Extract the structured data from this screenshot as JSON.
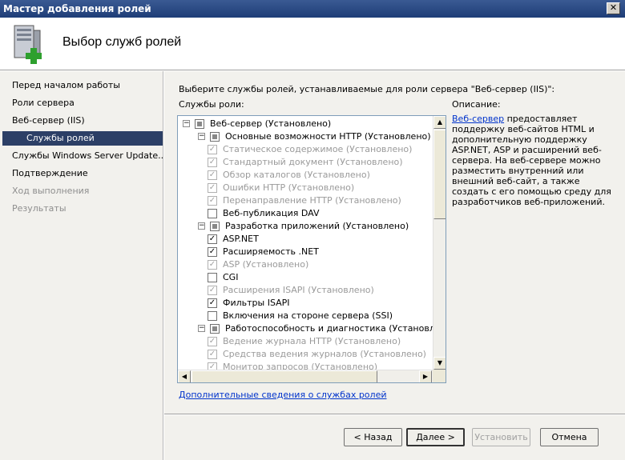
{
  "window": {
    "title": "Мастер добавления ролей",
    "close_glyph": "✕"
  },
  "header": {
    "title": "Выбор служб ролей",
    "icon": "server-add-icon"
  },
  "nav": [
    {
      "label": "Перед началом работы",
      "state": "normal"
    },
    {
      "label": "Роли сервера",
      "state": "normal"
    },
    {
      "label": "Веб-сервер (IIS)",
      "state": "normal"
    },
    {
      "label": "Службы ролей",
      "state": "active"
    },
    {
      "label": "Службы Windows Server Update...",
      "state": "normal"
    },
    {
      "label": "Подтверждение",
      "state": "normal"
    },
    {
      "label": "Ход выполнения",
      "state": "disabled"
    },
    {
      "label": "Результаты",
      "state": "disabled"
    }
  ],
  "main": {
    "instruction": "Выберите службы ролей, устанавливаемые для роли сервера \"Веб-сервер (IIS)\":",
    "roles_label": "Службы роли:",
    "description_label": "Описание:",
    "description_link": "Веб-сервер",
    "description_text": " предоставляет поддержку веб-сайтов HTML и дополнительную поддержку ASP.NET, ASP и расширений веб-сервера. На веб-сервере можно разместить внутренний или внешний веб-сайт, а также создать с его помощью среду для разработчиков веб-приложений.",
    "more_link": "Дополнительные сведения о службах ролей"
  },
  "tree": [
    {
      "label": "Веб-сервер (Установлено)",
      "level": 0,
      "expander": "−",
      "check": "indeterminate",
      "disabled": false
    },
    {
      "label": "Основные возможности HTTP (Установлено)",
      "level": 1,
      "expander": "−",
      "check": "indeterminate",
      "disabled": false
    },
    {
      "label": "Статическое содержимое (Установлено)",
      "level": 2,
      "expander": "",
      "check": "checked",
      "disabled": true
    },
    {
      "label": "Стандартный документ (Установлено)",
      "level": 2,
      "expander": "",
      "check": "checked",
      "disabled": true
    },
    {
      "label": "Обзор каталогов (Установлено)",
      "level": 2,
      "expander": "",
      "check": "checked",
      "disabled": true
    },
    {
      "label": "Ошибки HTTP (Установлено)",
      "level": 2,
      "expander": "",
      "check": "checked",
      "disabled": true
    },
    {
      "label": "Перенаправление HTTP (Установлено)",
      "level": 2,
      "expander": "",
      "check": "checked",
      "disabled": true
    },
    {
      "label": "Веб-публикация DAV",
      "level": 2,
      "expander": "",
      "check": "unchecked",
      "disabled": false
    },
    {
      "label": "Разработка приложений (Установлено)",
      "level": 1,
      "expander": "−",
      "check": "indeterminate",
      "disabled": false
    },
    {
      "label": "ASP.NET",
      "level": 2,
      "expander": "",
      "check": "checked",
      "disabled": false
    },
    {
      "label": "Расширяемость .NET",
      "level": 2,
      "expander": "",
      "check": "checked",
      "disabled": false
    },
    {
      "label": "ASP (Установлено)",
      "level": 2,
      "expander": "",
      "check": "checked",
      "disabled": true
    },
    {
      "label": "CGI",
      "level": 2,
      "expander": "",
      "check": "unchecked",
      "disabled": false
    },
    {
      "label": "Расширения ISAPI (Установлено)",
      "level": 2,
      "expander": "",
      "check": "checked",
      "disabled": true
    },
    {
      "label": "Фильтры ISAPI",
      "level": 2,
      "expander": "",
      "check": "checked",
      "disabled": false
    },
    {
      "label": "Включения на стороне сервера (SSI)",
      "level": 2,
      "expander": "",
      "check": "unchecked",
      "disabled": false
    },
    {
      "label": "Работоспособность и диагностика (Установлено)",
      "level": 1,
      "expander": "−",
      "check": "indeterminate",
      "disabled": false
    },
    {
      "label": "Ведение журнала HTTP (Установлено)",
      "level": 2,
      "expander": "",
      "check": "checked",
      "disabled": true
    },
    {
      "label": "Средства ведения журналов (Установлено)",
      "level": 2,
      "expander": "",
      "check": "checked",
      "disabled": true
    },
    {
      "label": "Монитор запросов (Установлено)",
      "level": 2,
      "expander": "",
      "check": "checked",
      "disabled": true
    }
  ],
  "buttons": {
    "back": "< Назад",
    "next": "Далее >",
    "install": "Установить",
    "cancel": "Отмена"
  }
}
